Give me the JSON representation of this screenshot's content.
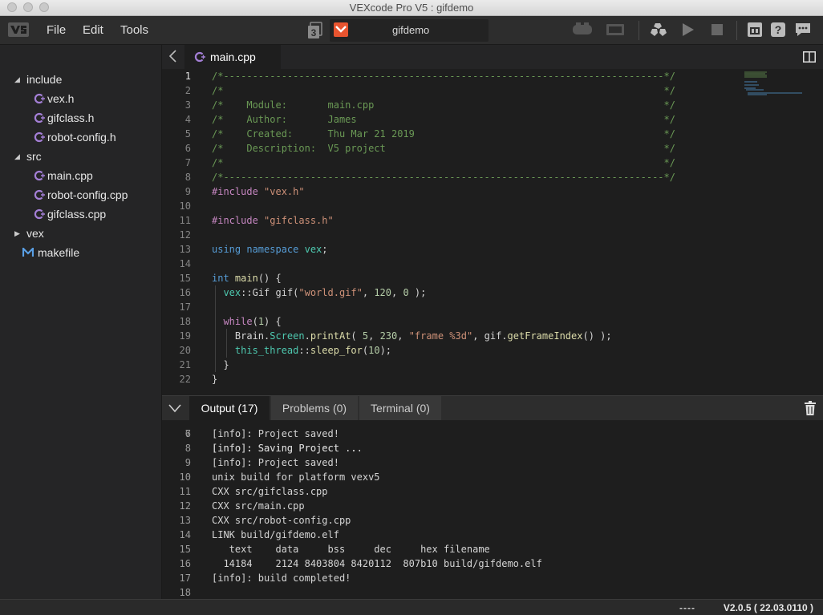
{
  "window": {
    "title": "VEXcode Pro V5 : gifdemo"
  },
  "menubar": {
    "items": [
      "File",
      "Edit",
      "Tools"
    ],
    "slot_number": "3",
    "project_name": "gifdemo",
    "accent_color": "#e8542f"
  },
  "sidebar": {
    "items": [
      {
        "label": "include",
        "kind": "folder",
        "expanded": true,
        "depth": 0
      },
      {
        "label": "vex.h",
        "kind": "cpp-file",
        "depth": 1
      },
      {
        "label": "gifclass.h",
        "kind": "cpp-file",
        "depth": 1
      },
      {
        "label": "robot-config.h",
        "kind": "cpp-file",
        "depth": 1
      },
      {
        "label": "src",
        "kind": "folder",
        "expanded": true,
        "depth": 0
      },
      {
        "label": "main.cpp",
        "kind": "cpp-file",
        "depth": 1
      },
      {
        "label": "robot-config.cpp",
        "kind": "cpp-file",
        "depth": 1
      },
      {
        "label": "gifclass.cpp",
        "kind": "cpp-file",
        "depth": 1
      },
      {
        "label": "vex",
        "kind": "folder",
        "expanded": false,
        "depth": 0
      },
      {
        "label": "makefile",
        "kind": "makefile",
        "depth": 0
      }
    ]
  },
  "editor": {
    "tab_label": "main.cpp",
    "active_line": 1,
    "lines": [
      [
        [
          "c-cm",
          "/*----------------------------------------------------------------------------*/"
        ]
      ],
      [
        [
          "c-cm",
          "/*                                                                            */"
        ]
      ],
      [
        [
          "c-cm",
          "/*    Module:       main.cpp                                                  */"
        ]
      ],
      [
        [
          "c-cm",
          "/*    Author:       James                                                     */"
        ]
      ],
      [
        [
          "c-cm",
          "/*    Created:      Thu Mar 21 2019                                           */"
        ]
      ],
      [
        [
          "c-cm",
          "/*    Description:  V5 project                                                */"
        ]
      ],
      [
        [
          "c-cm",
          "/*                                                                            */"
        ]
      ],
      [
        [
          "c-cm",
          "/*----------------------------------------------------------------------------*/"
        ]
      ],
      [
        [
          "c-pp",
          "#include "
        ],
        [
          "c-str",
          "\"vex.h\""
        ]
      ],
      [],
      [
        [
          "c-pp",
          "#include "
        ],
        [
          "c-str",
          "\"gifclass.h\""
        ]
      ],
      [],
      [
        [
          "c-kw",
          "using namespace "
        ],
        [
          "c-ns",
          "vex"
        ],
        [
          "c-pl",
          ";"
        ]
      ],
      [],
      [
        [
          "c-kw",
          "int "
        ],
        [
          "c-fn",
          "main"
        ],
        [
          "c-pl",
          "() {"
        ]
      ],
      [
        [
          "c-pl",
          "  "
        ],
        [
          "c-ns",
          "vex"
        ],
        [
          "c-pl",
          "::Gif gif("
        ],
        [
          "c-str",
          "\"world.gif\""
        ],
        [
          "c-pl",
          ", "
        ],
        [
          "c-num",
          "120"
        ],
        [
          "c-pl",
          ", "
        ],
        [
          "c-num",
          "0"
        ],
        [
          "c-pl",
          " );"
        ]
      ],
      [],
      [
        [
          "c-pl",
          "  "
        ],
        [
          "c-cf",
          "while"
        ],
        [
          "c-pl",
          "("
        ],
        [
          "c-num",
          "1"
        ],
        [
          "c-pl",
          ") {"
        ]
      ],
      [
        [
          "c-pl",
          "    Brain."
        ],
        [
          "c-ns",
          "Screen"
        ],
        [
          "c-pl",
          "."
        ],
        [
          "c-fn",
          "printAt"
        ],
        [
          "c-pl",
          "( "
        ],
        [
          "c-num",
          "5"
        ],
        [
          "c-pl",
          ", "
        ],
        [
          "c-num",
          "230"
        ],
        [
          "c-pl",
          ", "
        ],
        [
          "c-str",
          "\"frame %3d\""
        ],
        [
          "c-pl",
          ", gif."
        ],
        [
          "c-fn",
          "getFrameIndex"
        ],
        [
          "c-pl",
          "() );"
        ]
      ],
      [
        [
          "c-pl",
          "    "
        ],
        [
          "c-ns",
          "this_thread"
        ],
        [
          "c-pl",
          "::"
        ],
        [
          "c-fn",
          "sleep_for"
        ],
        [
          "c-pl",
          "("
        ],
        [
          "c-num",
          "10"
        ],
        [
          "c-pl",
          ");"
        ]
      ],
      [
        [
          "c-pl",
          "  }"
        ]
      ],
      [
        [
          "c-pl",
          "}"
        ]
      ]
    ]
  },
  "panel": {
    "tabs": [
      {
        "label": "Output (17)",
        "active": true
      },
      {
        "label": "Problems (0)",
        "active": false
      },
      {
        "label": "Terminal (0)",
        "active": false
      }
    ],
    "partial_line": {
      "num": "6",
      "text": "[info]: Saving Project ..."
    },
    "output_lines": [
      {
        "num": "7",
        "text": "[info]: Project saved!"
      },
      {
        "num": "8",
        "text": "[info]: Saving Project ..."
      },
      {
        "num": "9",
        "text": "[info]: Project saved!"
      },
      {
        "num": "10",
        "text": "unix build for platform vexv5"
      },
      {
        "num": "11",
        "text": "CXX src/gifclass.cpp"
      },
      {
        "num": "12",
        "text": "CXX src/main.cpp"
      },
      {
        "num": "13",
        "text": "CXX src/robot-config.cpp"
      },
      {
        "num": "14",
        "text": "LINK build/gifdemo.elf"
      },
      {
        "num": "15",
        "text": "   text    data     bss     dec     hex filename"
      },
      {
        "num": "16",
        "text": "  14184    2124 8403804 8420112  807b10 build/gifdemo.elf"
      },
      {
        "num": "17",
        "text": "[info]: build completed!"
      },
      {
        "num": "18",
        "text": ""
      }
    ]
  },
  "statusbar": {
    "indicator": "----",
    "version": "V2.0.5 ( 22.03.0110 )"
  }
}
